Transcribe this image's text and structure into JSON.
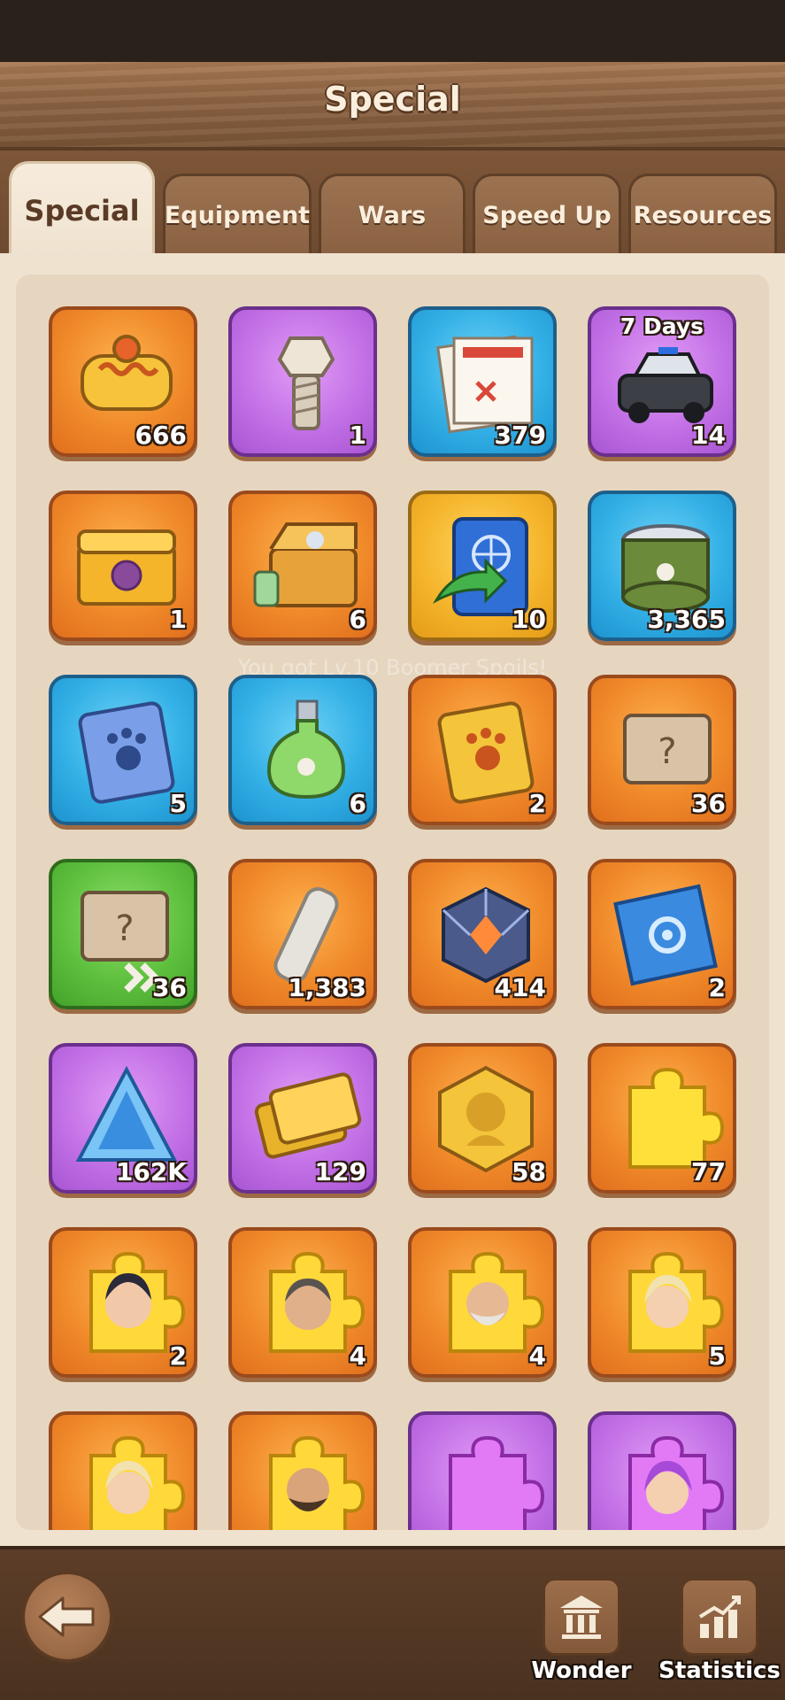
{
  "header": {
    "title": "Special"
  },
  "tabs": [
    {
      "label": "Special",
      "active": true
    },
    {
      "label": "Equipment",
      "active": false
    },
    {
      "label": "Wars",
      "active": false
    },
    {
      "label": "Speed Up",
      "active": false
    },
    {
      "label": "Resources",
      "active": false
    }
  ],
  "watermark": "You got Lv.10 Boomer Spoils!",
  "items": [
    {
      "icon": "engine-core-icon",
      "count": "666",
      "color": "orange"
    },
    {
      "icon": "bolt-icon",
      "count": "1",
      "color": "purple"
    },
    {
      "icon": "confidential-document-icon",
      "count": "379",
      "color": "blue"
    },
    {
      "icon": "police-car-icon",
      "count": "14",
      "color": "purple",
      "tag": "7 Days"
    },
    {
      "icon": "golden-chest-icon",
      "count": "1",
      "color": "orange"
    },
    {
      "icon": "pet-supply-chest-icon",
      "count": "6",
      "color": "orange"
    },
    {
      "icon": "passport-transfer-icon",
      "count": "10",
      "color": "gold"
    },
    {
      "icon": "pet-food-can-icon",
      "count": "3,365",
      "color": "blue"
    },
    {
      "icon": "blue-paw-book-icon",
      "count": "5",
      "color": "blue"
    },
    {
      "icon": "paw-potion-icon",
      "count": "6",
      "color": "blue"
    },
    {
      "icon": "gold-paw-book-icon",
      "count": "2",
      "color": "orange"
    },
    {
      "icon": "mystery-crate-icon",
      "count": "36",
      "color": "orange"
    },
    {
      "icon": "fast-mystery-crate-icon",
      "count": "36",
      "color": "green"
    },
    {
      "icon": "metal-ingot-icon",
      "count": "1,383",
      "color": "orange"
    },
    {
      "icon": "energy-cube-icon",
      "count": "414",
      "color": "orange"
    },
    {
      "icon": "blueprint-scroll-icon",
      "count": "2",
      "color": "orange"
    },
    {
      "icon": "crystal-prism-icon",
      "count": "162K",
      "color": "purple"
    },
    {
      "icon": "gold-bars-icon",
      "count": "129",
      "color": "purple"
    },
    {
      "icon": "hero-medal-icon",
      "count": "58",
      "color": "orange"
    },
    {
      "icon": "gold-puzzle-piece-icon",
      "count": "77",
      "color": "orange"
    },
    {
      "icon": "hero-shard-dark-hair-icon",
      "count": "2",
      "color": "orange"
    },
    {
      "icon": "hero-shard-scarred-man-icon",
      "count": "4",
      "color": "orange"
    },
    {
      "icon": "hero-shard-old-man-icon",
      "count": "4",
      "color": "orange"
    },
    {
      "icon": "hero-shard-blonde-icon",
      "count": "5",
      "color": "orange"
    },
    {
      "icon": "hero-shard-blonde-woman-icon",
      "count": "",
      "color": "orange"
    },
    {
      "icon": "hero-shard-bearded-man-icon",
      "count": "",
      "color": "orange"
    },
    {
      "icon": "purple-puzzle-piece-icon",
      "count": "",
      "color": "purple"
    },
    {
      "icon": "hero-shard-purple-hair-icon",
      "count": "",
      "color": "purple"
    }
  ],
  "bottom_nav": {
    "wonder_label": "Wonder",
    "statistics_label": "Statistics"
  }
}
